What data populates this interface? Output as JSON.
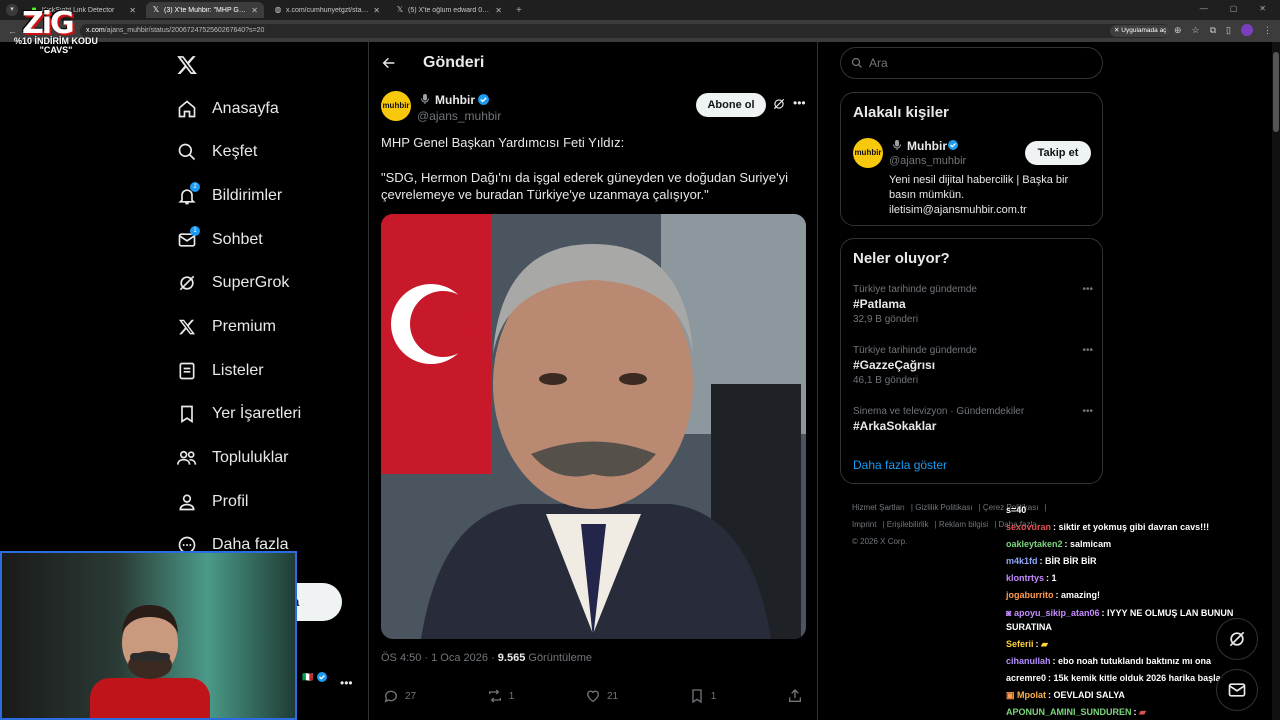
{
  "browser": {
    "tabs": [
      {
        "label": "KickSight Link Detector",
        "icon": "kick-icon",
        "active": false
      },
      {
        "label": "(3) X'te Muhbir: \"MHP Gen...",
        "icon": "x-icon",
        "active": true
      },
      {
        "label": "x.com/cumhuriyetgzt/status/20...",
        "icon": "globe-icon",
        "active": false
      },
      {
        "label": "(5) X'te oğlum edward 06: \"ken...",
        "icon": "x-icon",
        "active": false
      }
    ],
    "url_prefix": "x.com",
    "url_path": "/ajans_muhbir/status/2006724752560267640?s=20",
    "open_in_app": "Uygulamada aç"
  },
  "overlay": {
    "logo": "ZiG",
    "promo_line1": "%10 İNDİRİM KODU",
    "promo_line2": "\"CAVS\""
  },
  "nav": {
    "items": [
      {
        "label": "Anasayfa",
        "icon": "home-icon"
      },
      {
        "label": "Keşfet",
        "icon": "search-icon"
      },
      {
        "label": "Bildirimler",
        "icon": "bell-icon",
        "badge": "2"
      },
      {
        "label": "Sohbet",
        "icon": "mail-icon",
        "badge": "1"
      },
      {
        "label": "SuperGrok",
        "icon": "grok-icon"
      },
      {
        "label": "Premium",
        "icon": "x-icon"
      },
      {
        "label": "Listeler",
        "icon": "list-icon"
      },
      {
        "label": "Yer İşaretleri",
        "icon": "bookmark-icon"
      },
      {
        "label": "Topluluklar",
        "icon": "people-icon"
      },
      {
        "label": "Profil",
        "icon": "person-icon"
      },
      {
        "label": "Daha fazla",
        "icon": "more-circle-icon"
      }
    ],
    "post_button": "a"
  },
  "post": {
    "header_title": "Gönderi",
    "author_name": "Muhbir",
    "author_handle": "@ajans_muhbir",
    "avatar_text": "muhbir",
    "subscribe": "Abone ol",
    "text_line1": "MHP Genel Başkan Yardımcısı Feti Yıldız:",
    "text_line2": "\"SDG, Hermon Dağı'nı da işgal ederek güneyden ve doğudan Suriye'yi çevrelemeye ve buradan Türkiye'ye uzanmaya çalışıyor.\"",
    "time": "ÖS 4:50 · 1 Oca 2026 · ",
    "views": "9.565",
    "views_label": " Görüntüleme",
    "replies": "27",
    "reposts": "1",
    "likes": "21",
    "bookmarks": "1"
  },
  "right": {
    "search_placeholder": "Ara",
    "related": {
      "title": "Alakalı kişiler",
      "name": "Muhbir",
      "handle": "@ajans_muhbir",
      "avatar_text": "muhbir",
      "follow": "Takip et",
      "bio": "Yeni nesil dijital habercilik | Başka bir basın mümkün. iletisim@ajansmuhbir.com.tr"
    },
    "trends": {
      "title": "Neler oluyor?",
      "items": [
        {
          "context": "Türkiye tarihinde gündemde",
          "tag": "#Patlama",
          "count": "32,9 B gönderi"
        },
        {
          "context": "Türkiye tarihinde gündemde",
          "tag": "#GazzeÇağrısı",
          "count": "46,1 B gönderi"
        },
        {
          "context": "Sinema ve televizyon · Gündemdekiler",
          "tag": "#ArkaSokaklar",
          "count": ""
        }
      ],
      "show_more": "Daha fazla göster"
    },
    "footer": {
      "links": [
        "Hizmet Şartları",
        "Gizlilik Politikası",
        "Çerez Politikası",
        "Imprint",
        "Erişilebilirlik",
        "Reklam bilgisi",
        "Daha fazla"
      ],
      "copyright": "© 2026 X Corp."
    }
  },
  "chat": [
    {
      "user": "",
      "text": "s=40",
      "color": "#ffffff"
    },
    {
      "user": "sexovuran",
      "text": "siktir et yokmuş gibi davran cavs!!!",
      "color": "#e05252"
    },
    {
      "user": "oakleytaken2",
      "text": "salmicam",
      "color": "#7cd67c"
    },
    {
      "user": "m4k1fd",
      "text": "BİR BİR BİR",
      "color": "#8fa7ff"
    },
    {
      "user": "klontrtys",
      "text": "1",
      "color": "#c78cff"
    },
    {
      "user": "jogaburrito",
      "text": "amazing!",
      "color": "#ff9a4d"
    },
    {
      "user": "apoyu_sikip_atan06",
      "text": "IYYY NE OLMUŞ LAN BUNUN SURATINA",
      "color": "#c78cff"
    },
    {
      "user": "Seferii",
      "text": "",
      "color": "#ffd23a"
    },
    {
      "user": "cihanullah",
      "text": "ebo noah tutuklandı baktınız mı ona",
      "color": "#b48cff"
    },
    {
      "user": "acremre0",
      "text": "15k kemik kitle olduk 2026 harika başladı",
      "color": "#ffffff"
    },
    {
      "user": "Mpolat",
      "text": "OEVLADI SALYA",
      "color": "#ffb14d"
    },
    {
      "user": "APONUN_AMINI_SUNDUREN",
      "text": "",
      "color": "#7cd67c"
    }
  ]
}
